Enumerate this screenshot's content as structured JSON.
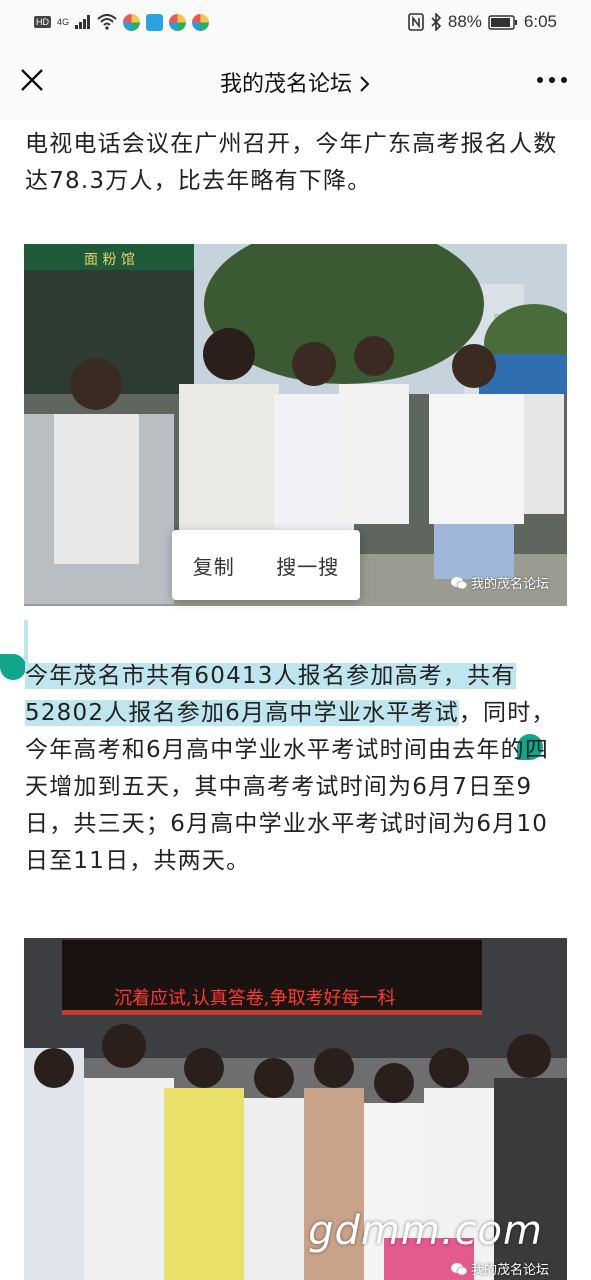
{
  "status": {
    "hd": "HD",
    "network": "4G",
    "battery_pct": "88%",
    "time": "6:05"
  },
  "navbar": {
    "title": "我的茂名论坛"
  },
  "article": {
    "para1": "电视电话会议在广州召开，今年广东高考报名人数达78.3万人，比去年略有下降。",
    "para2_selected": "今年茂名市共有60413人报名参加高考，共有52802人报名参加6月高中学业水平考试",
    "para2_rest": "，同时，今年高考和6月高中学业水平考试时间由去年的四天增加到五天，其中高考考试时间为6月7日至9日，共三天；6月高中学业水平考试时间为6月10日至11日，共两天。"
  },
  "photo1": {
    "sign": "面 粉 馆",
    "watermark": "我的茂名论坛"
  },
  "photo2": {
    "banner": "沉着应试,认真答卷,争取考好每一科",
    "site_mark": "gdmm.com",
    "watermark": "我的茂名论坛"
  },
  "popup": {
    "copy": "复制",
    "search": "搜一搜"
  },
  "colors": {
    "selection": "#bfe5ee",
    "handle": "#11a58b",
    "banner_text": "#ff3b30"
  }
}
